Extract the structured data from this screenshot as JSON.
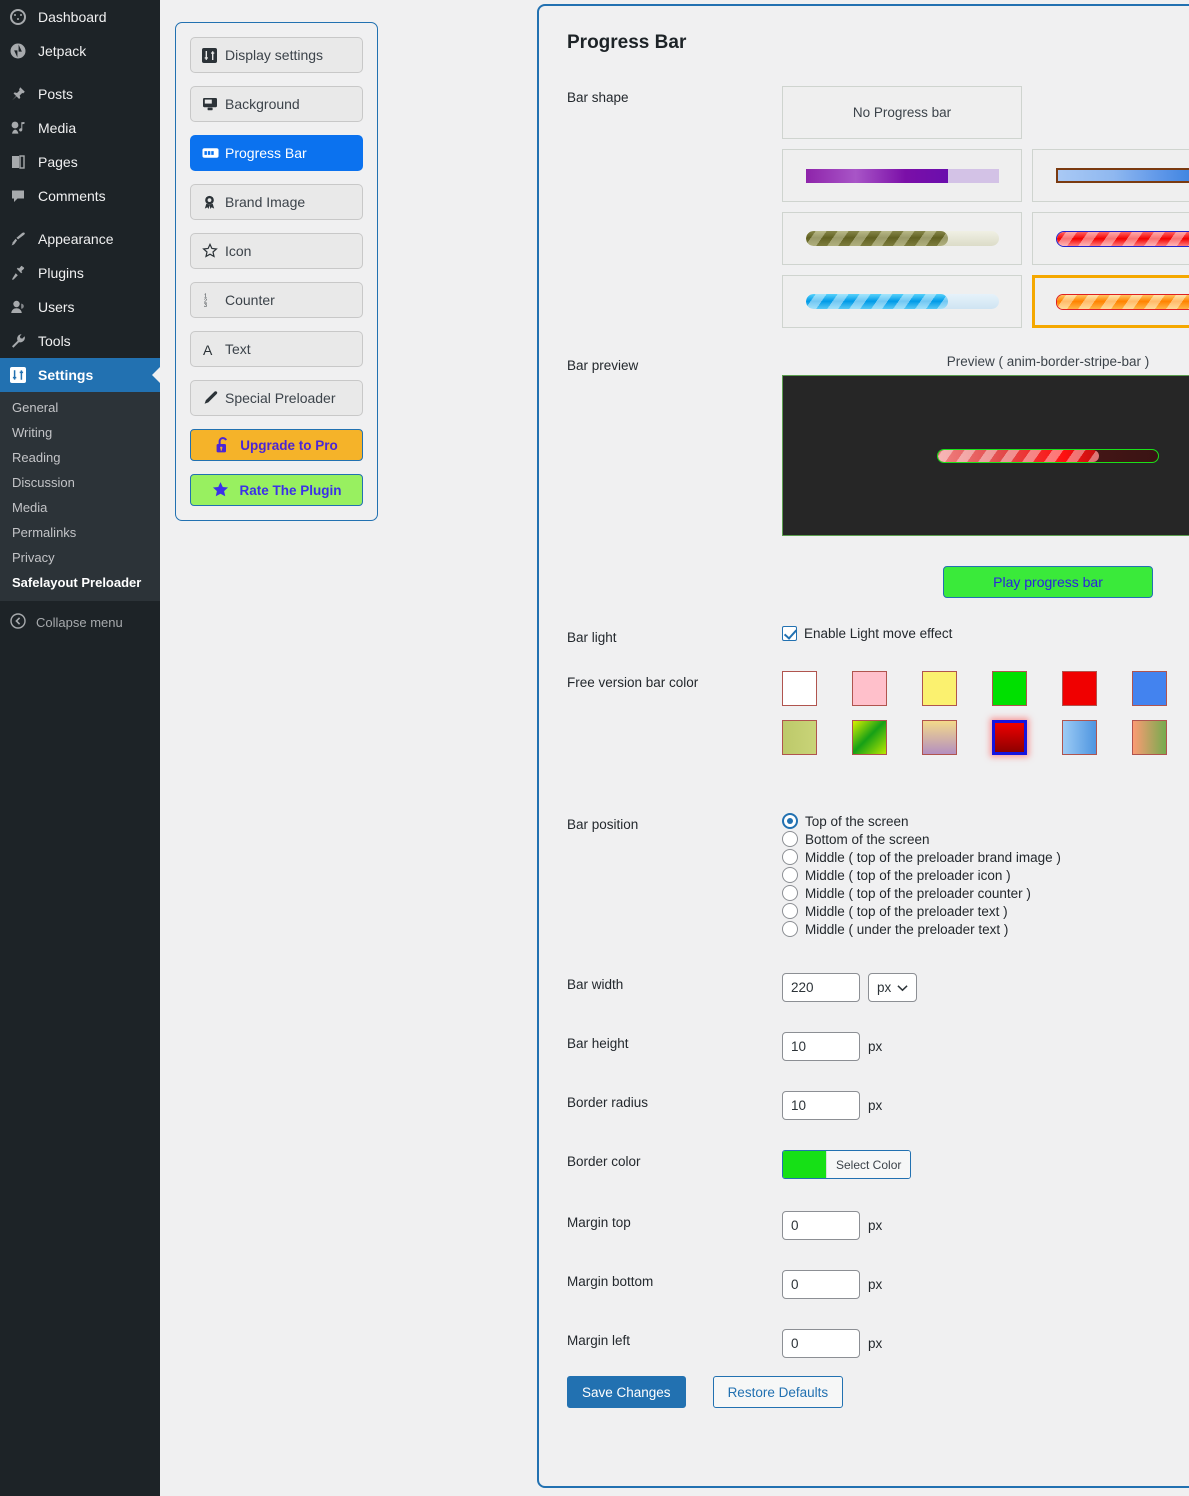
{
  "sidebar": {
    "items": [
      {
        "label": "Dashboard",
        "icon": "dashboard-icon",
        "current": false,
        "sep_after": false
      },
      {
        "label": "Jetpack",
        "icon": "jetpack-icon",
        "current": false,
        "sep_after": true
      },
      {
        "label": "Posts",
        "icon": "pin-icon",
        "current": false,
        "sep_after": false
      },
      {
        "label": "Media",
        "icon": "media-icon",
        "current": false,
        "sep_after": false
      },
      {
        "label": "Pages",
        "icon": "pages-icon",
        "current": false,
        "sep_after": false
      },
      {
        "label": "Comments",
        "icon": "comments-icon",
        "current": false,
        "sep_after": true
      },
      {
        "label": "Appearance",
        "icon": "brush-icon",
        "current": false,
        "sep_after": false
      },
      {
        "label": "Plugins",
        "icon": "plugins-icon",
        "current": false,
        "sep_after": false
      },
      {
        "label": "Users",
        "icon": "users-icon",
        "current": false,
        "sep_after": false
      },
      {
        "label": "Tools",
        "icon": "wrench-icon",
        "current": false,
        "sep_after": false
      },
      {
        "label": "Settings",
        "icon": "settings-icon",
        "current": true,
        "sep_after": false
      }
    ],
    "submenu": [
      {
        "label": "General",
        "current": false
      },
      {
        "label": "Writing",
        "current": false
      },
      {
        "label": "Reading",
        "current": false
      },
      {
        "label": "Discussion",
        "current": false
      },
      {
        "label": "Media",
        "current": false
      },
      {
        "label": "Permalinks",
        "current": false
      },
      {
        "label": "Privacy",
        "current": false
      },
      {
        "label": "Safelayout Preloader",
        "current": true
      }
    ],
    "collapse_label": "Collapse menu"
  },
  "tabs": {
    "items": [
      {
        "label": "Display settings",
        "icon": "sliders-icon",
        "active": false
      },
      {
        "label": "Background",
        "icon": "monitor-icon",
        "active": false
      },
      {
        "label": "Progress Bar",
        "icon": "progress-bar-icon",
        "active": true
      },
      {
        "label": "Brand Image",
        "icon": "award-icon",
        "active": false
      },
      {
        "label": "Icon",
        "icon": "star-outline-icon",
        "active": false
      },
      {
        "label": "Counter",
        "icon": "number-list-icon",
        "active": false
      },
      {
        "label": "Text",
        "icon": "letter-a-icon",
        "active": false
      },
      {
        "label": "Special Preloader",
        "icon": "pencil-icon",
        "active": false
      }
    ],
    "upgrade": {
      "label": "Upgrade to Pro",
      "icon": "unlock-icon",
      "bg": "#f5b329",
      "color": "#4b26d6"
    },
    "rate": {
      "label": "Rate The Plugin",
      "icon": "star-filled-icon",
      "bg": "#98f060",
      "color": "#3b30e8"
    }
  },
  "main": {
    "title": "Progress Bar",
    "bar_shape": {
      "label": "Bar shape",
      "no_bar_label": "No Progress bar",
      "options": [
        {
          "name": "flat-purple-bar",
          "selected": false
        },
        {
          "name": "flat-blue-bordered-bar",
          "selected": false
        },
        {
          "name": "olive-stripe-bar",
          "selected": false
        },
        {
          "name": "red-stripe-border-bar",
          "selected": false
        },
        {
          "name": "cyan-stripe-bar",
          "selected": false
        },
        {
          "name": "anim-border-stripe-bar",
          "selected": true
        }
      ]
    },
    "bar_preview": {
      "label": "Bar preview",
      "caption": "Preview ( anim-border-stripe-bar )",
      "play_label": "Play progress bar",
      "preview_bg": "#262626",
      "preview_border": "#5b9e4e"
    },
    "bar_light": {
      "label": "Bar light",
      "checkbox_label": "Enable Light move effect",
      "checked": true
    },
    "bar_color": {
      "label": "Free version bar color",
      "row1": [
        {
          "name": "white",
          "css": "#ffffff",
          "selected": false
        },
        {
          "name": "pink",
          "css": "#ffc0cb",
          "selected": false
        },
        {
          "name": "yellow",
          "css": "#fbf16f",
          "selected": false
        },
        {
          "name": "green",
          "css": "#00e000",
          "selected": false
        },
        {
          "name": "red",
          "css": "#f00000",
          "selected": false
        },
        {
          "name": "blue",
          "css": "#4383ef",
          "selected": false
        },
        {
          "name": "black",
          "css": "#141414",
          "selected": false
        }
      ],
      "row2": [
        {
          "name": "olive-gradient",
          "css": "linear-gradient(90deg,#bdc96a,#c9d478)",
          "selected": false
        },
        {
          "name": "green-yellow-diagonal",
          "css": "linear-gradient(135deg,#d8f000 0%,#16a016 48%,#b9e800 100%)",
          "selected": false
        },
        {
          "name": "gold-to-mauve",
          "css": "linear-gradient(180deg,#f3d98a,#b48fc0)",
          "selected": false
        },
        {
          "name": "dark-red",
          "css": "linear-gradient(180deg,#ee0000,#8e0000)",
          "selected": true
        },
        {
          "name": "light-blue",
          "css": "linear-gradient(90deg,#9ccbf5,#4e95e0)",
          "selected": false
        },
        {
          "name": "salmon-to-green",
          "css": "linear-gradient(90deg,#fb9b74,#76ab4e)",
          "selected": false
        },
        {
          "name": "dark-red-brown-diagonal",
          "css": "linear-gradient(135deg,#7a2b08 0%,#1a0a04 48%,#b00000 100%)",
          "selected": false
        }
      ]
    },
    "bar_position": {
      "label": "Bar position",
      "options": [
        {
          "label": "Top of the screen",
          "checked": true
        },
        {
          "label": "Bottom of the screen",
          "checked": false
        },
        {
          "label": "Middle ( top of the preloader brand image )",
          "checked": false
        },
        {
          "label": "Middle ( top of the preloader icon )",
          "checked": false
        },
        {
          "label": "Middle ( top of the preloader counter )",
          "checked": false
        },
        {
          "label": "Middle ( top of the preloader text )",
          "checked": false
        },
        {
          "label": "Middle ( under the preloader text )",
          "checked": false
        }
      ]
    },
    "fields": {
      "bar_width": {
        "label": "Bar width",
        "value": "220",
        "unit": "px"
      },
      "bar_height": {
        "label": "Bar height",
        "value": "10",
        "unit": "px"
      },
      "border_radius": {
        "label": "Border radius",
        "value": "10",
        "unit": "px"
      },
      "border_color": {
        "label": "Border color",
        "swatch": "#16e016",
        "button_label": "Select Color"
      },
      "margin_top": {
        "label": "Margin top",
        "value": "0",
        "unit": "px"
      },
      "margin_bottom": {
        "label": "Margin bottom",
        "value": "0",
        "unit": "px"
      },
      "margin_left": {
        "label": "Margin left",
        "value": "0",
        "unit": "px"
      }
    },
    "footer": {
      "save_label": "Save Changes",
      "restore_label": "Restore Defaults"
    }
  }
}
